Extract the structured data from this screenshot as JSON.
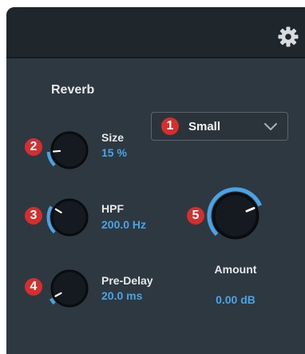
{
  "header": {
    "gear_icon": "gear-icon"
  },
  "reverb": {
    "title": "Reverb",
    "type_select": {
      "selected": "Small"
    },
    "controls": [
      {
        "badge": "2",
        "label": "Size",
        "value": "15 %",
        "level": 0.15
      },
      {
        "badge": "3",
        "label": "HPF",
        "value": "200.0 Hz",
        "level": 0.28
      },
      {
        "badge": "4",
        "label": "Pre-Delay",
        "value": "20.0 ms",
        "level": 0.06
      }
    ],
    "amount": {
      "badge": "5",
      "label": "Amount",
      "value": "0.00 dB",
      "level": 0.75
    }
  },
  "dropdown_badge": "1",
  "colors": {
    "accent": "#4aa3e4",
    "badge": "#d32f2f",
    "panel": "#2e3840",
    "header": "#1f262c"
  }
}
